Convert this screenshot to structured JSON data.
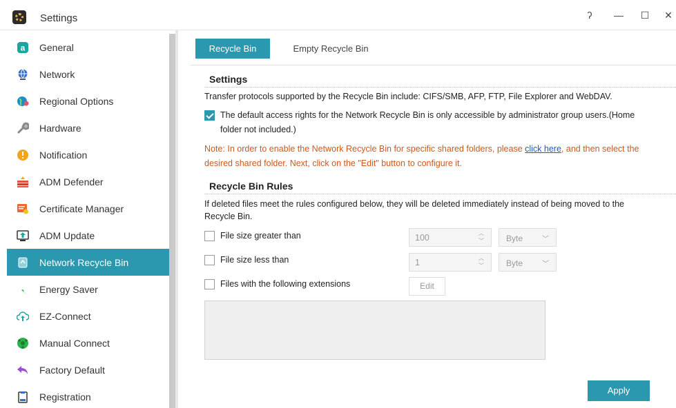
{
  "window": {
    "title": "Settings",
    "controls": {
      "help": "ʔ",
      "minimize": "—",
      "maximize": "☐",
      "close": "✕"
    }
  },
  "sidebar": {
    "items": [
      {
        "label": "General",
        "icon": "general-icon",
        "active": false
      },
      {
        "label": "Network",
        "icon": "globe-icon",
        "active": false
      },
      {
        "label": "Regional Options",
        "icon": "map-pin-globe-icon",
        "active": false
      },
      {
        "label": "Hardware",
        "icon": "wrench-icon",
        "active": false
      },
      {
        "label": "Notification",
        "icon": "alert-icon",
        "active": false
      },
      {
        "label": "ADM Defender",
        "icon": "firewall-icon",
        "active": false
      },
      {
        "label": "Certificate Manager",
        "icon": "certificate-icon",
        "active": false
      },
      {
        "label": "ADM Update",
        "icon": "update-icon",
        "active": false
      },
      {
        "label": "Network Recycle Bin",
        "icon": "recycle-bin-icon",
        "active": true
      },
      {
        "label": "Energy Saver",
        "icon": "lightning-icon",
        "active": false
      },
      {
        "label": "EZ-Connect",
        "icon": "cloud-upload-icon",
        "active": false
      },
      {
        "label": "Manual Connect",
        "icon": "network-globe-icon",
        "active": false
      },
      {
        "label": "Factory Default",
        "icon": "undo-arrow-icon",
        "active": false
      },
      {
        "label": "Registration",
        "icon": "clipboard-icon",
        "active": false
      }
    ]
  },
  "tabs": [
    {
      "label": "Recycle Bin",
      "active": true
    },
    {
      "label": "Empty Recycle Bin",
      "active": false
    }
  ],
  "settings": {
    "title": "Settings",
    "protocols_text": "Transfer protocols supported by the Recycle Bin include: CIFS/SMB, AFP, FTP, File Explorer and WebDAV.",
    "access_checkbox_line1": "The default access rights for the Network Recycle Bin is only accessible by administrator group users.(Home",
    "access_checkbox_line2": "folder not included.)",
    "access_checked": true,
    "note_part1": "Note: In order to enable the Network Recycle Bin for specific shared folders, please ",
    "note_link": "click here",
    "note_part2": ", and then select the",
    "note_line2": "desired shared folder. Next, click on the \"Edit\" button to configure it."
  },
  "rules": {
    "title": "Recycle Bin Rules",
    "desc_line1": "If deleted files meet the rules configured below, they will be deleted immediately instead of being moved to the",
    "desc_line2": "Recycle Bin.",
    "size_greater_label": "File size greater than",
    "size_greater_value": "100",
    "size_greater_unit": "Byte",
    "size_less_label": "File size less than",
    "size_less_value": "1",
    "size_less_unit": "Byte",
    "extensions_label": "Files with the following extensions",
    "edit_label": "Edit"
  },
  "apply_label": "Apply",
  "colors": {
    "accent": "#2a98ae",
    "note": "#d1571b",
    "link": "#1a55d6"
  }
}
